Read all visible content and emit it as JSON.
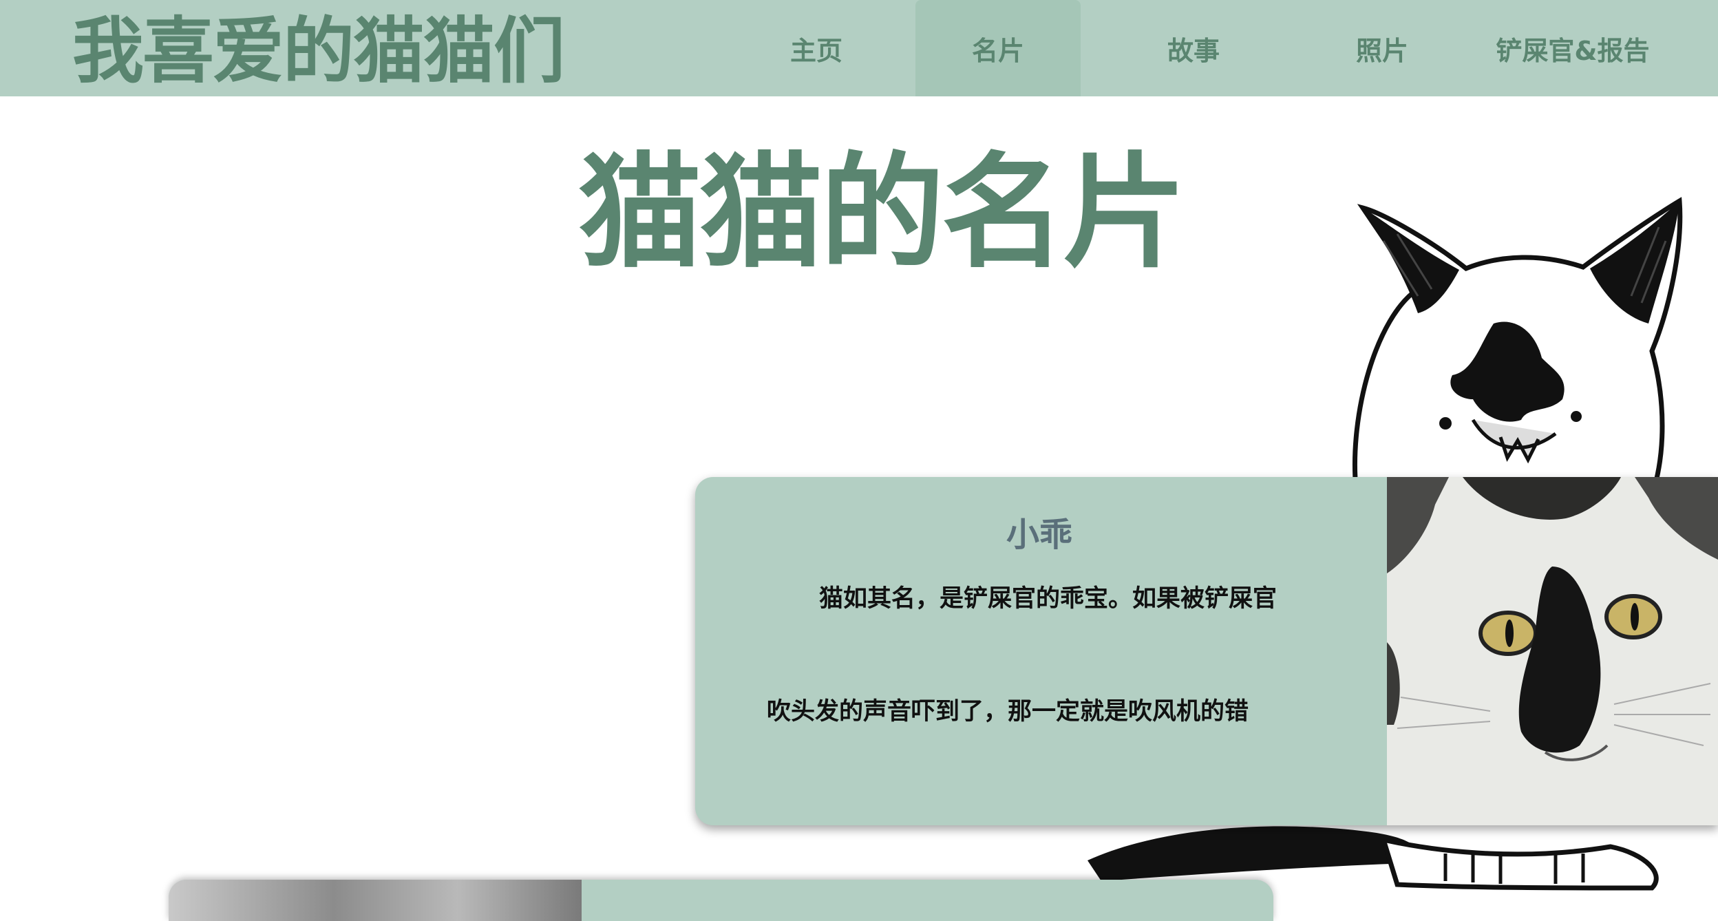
{
  "header": {
    "site_title": "我喜爱的猫猫们",
    "nav": [
      {
        "label": "主页",
        "active": false
      },
      {
        "label": "名片",
        "active": true
      },
      {
        "label": "故事",
        "active": false
      },
      {
        "label": "照片",
        "active": false
      },
      {
        "label": "铲屎官&报告",
        "active": false
      }
    ]
  },
  "main": {
    "title": "猫猫的名片",
    "cards": [
      {
        "name": "小乖",
        "desc_line1": "猫如其名，是铲屎官的乖宝。如果被铲屎官",
        "desc_line2": "吹头发的声音吓到了，那一定就是吹风机的错"
      }
    ]
  },
  "colors": {
    "navbar_bg": "#b3cfc3",
    "accent_green": "#5a8570",
    "card_bg": "#b3cfc3",
    "nav_active_bg": "#a5c6b7"
  }
}
